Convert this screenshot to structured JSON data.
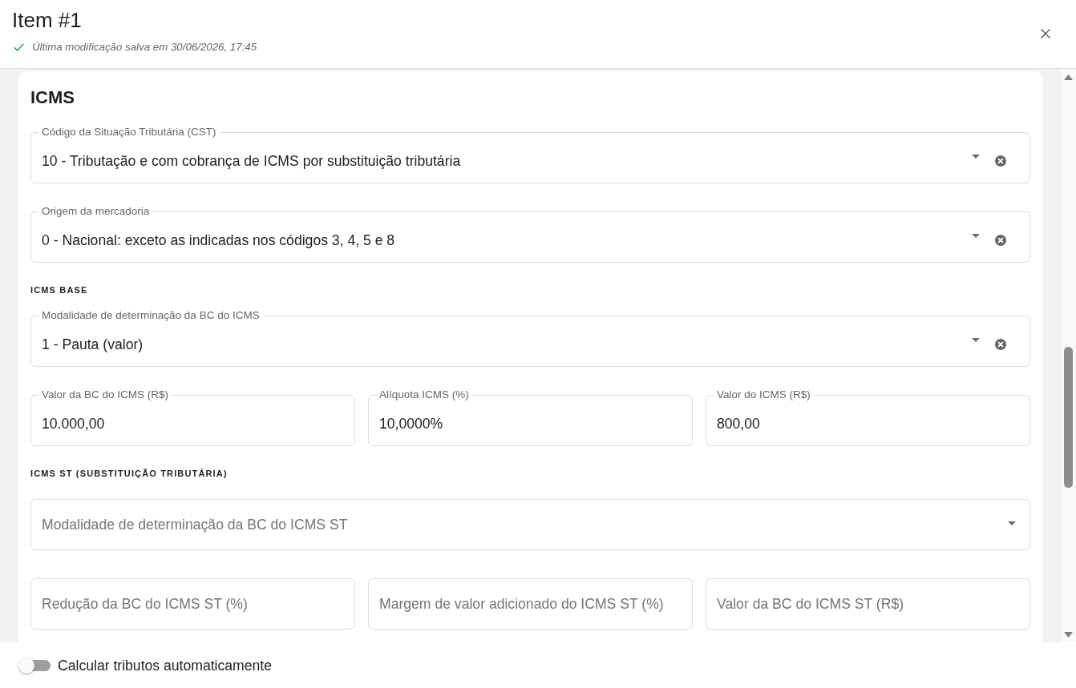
{
  "header": {
    "title": "Item #1",
    "saved": true,
    "save_status": "Última modificação salva em 30/06/2026, 17:45"
  },
  "section": {
    "title": "ICMS",
    "blocks": [
      {
        "kind": "fields",
        "fields": [
          {
            "kind": "select",
            "label": "Código da Situação Tributária (CST)",
            "value": "10 - Tributação e com cobrança de ICMS por substituição tributária",
            "clearable": true
          }
        ]
      },
      {
        "kind": "fields",
        "fields": [
          {
            "kind": "select",
            "label": "Origem da mercadoria",
            "value": "0 - Nacional: exceto as indicadas nos códigos 3, 4, 5 e 8",
            "clearable": true
          }
        ]
      },
      {
        "kind": "subheading",
        "text": "ICMS BASE"
      },
      {
        "kind": "fields",
        "fields": [
          {
            "kind": "select",
            "label": "Modalidade de determinação da BC do ICMS",
            "value": "1 - Pauta (valor)",
            "clearable": true
          }
        ]
      },
      {
        "kind": "fields",
        "fields": [
          {
            "kind": "input",
            "label": "Valor da BC do ICMS (R$)",
            "value": "10.000,00"
          },
          {
            "kind": "input",
            "label": "Alíquota ICMS (%)",
            "value": "10,0000%"
          },
          {
            "kind": "input",
            "label": "Valor do ICMS (R$)",
            "value": "800,00"
          }
        ]
      },
      {
        "kind": "subheading",
        "text": "ICMS ST (SUBSTITUIÇÃO TRIBUTÁRIA)"
      },
      {
        "kind": "fields",
        "fields": [
          {
            "kind": "select",
            "placeholder": "Modalidade de determinação da BC do ICMS ST",
            "clearable": false
          }
        ]
      },
      {
        "kind": "fields",
        "fields": [
          {
            "kind": "input",
            "placeholder": "Redução da BC do ICMS ST (%)"
          },
          {
            "kind": "input",
            "placeholder": "Margem de valor adicionado do ICMS ST (%)"
          },
          {
            "kind": "input",
            "placeholder": "Valor da BC do ICMS ST (R$)"
          }
        ]
      }
    ]
  },
  "footer": {
    "toggle": {
      "label": "Calcular tributos automaticamente",
      "on": false
    }
  }
}
